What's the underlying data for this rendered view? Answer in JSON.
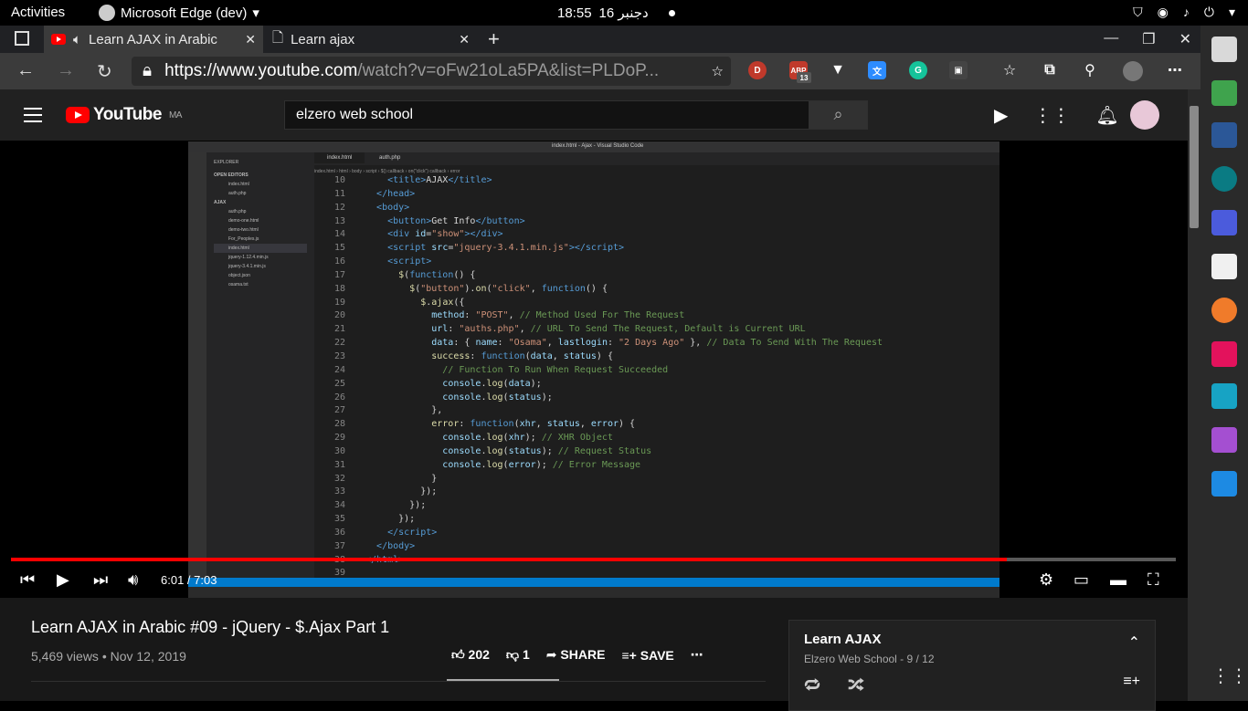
{
  "topbar": {
    "activities": "Activities",
    "app": "Microsoft Edge (dev)",
    "time": "18:55",
    "date": "16 دجنبر"
  },
  "tabs": [
    {
      "label": "Learn AJAX in Arabic"
    },
    {
      "label": "Learn ajax"
    }
  ],
  "url": {
    "base": "https://www.youtube.com",
    "rest": "/watch?v=oFw21oLa5PA&list=PLDoP..."
  },
  "extensions": {
    "badge_count": "13",
    "abp_label": "ABP",
    "d_label": "D",
    "g_label": "G"
  },
  "youtube": {
    "logo_text": "YouTube",
    "region": "MA",
    "search_value": "elzero web school"
  },
  "player": {
    "time_current": "6:01",
    "time_total": "7:03",
    "time_display": "6:01 / 7:03",
    "progress_fraction": 0.855
  },
  "editor": {
    "window_title": "index.html - Ajax - Visual Studio Code",
    "tab_active": "index.html",
    "tab_other": "auth.php",
    "breadcrumb": "index.html › html › body › script › $() callback › on(\"click\") callback › error",
    "explorer_title": "EXPLORER",
    "open_editors": "OPEN EDITORS",
    "folder": "AJAX",
    "files": [
      "auth.php",
      "demo-one.html",
      "demo-two.html",
      "For_Peoples.js",
      "index.html",
      "jquery-1.12.4.min.js",
      "jquery-3.4.1.min.js",
      "object.json",
      "osama.txt"
    ]
  },
  "video_info": {
    "title": "Learn AJAX in Arabic #09 - jQuery - $.Ajax Part 1",
    "meta": "5,469 views • Nov 12, 2019",
    "likes": "202",
    "dislikes": "1",
    "share": "SHARE",
    "save": "SAVE"
  },
  "playlist": {
    "title": "Learn AJAX",
    "sub": "Elzero Web School - 9 / 12"
  }
}
